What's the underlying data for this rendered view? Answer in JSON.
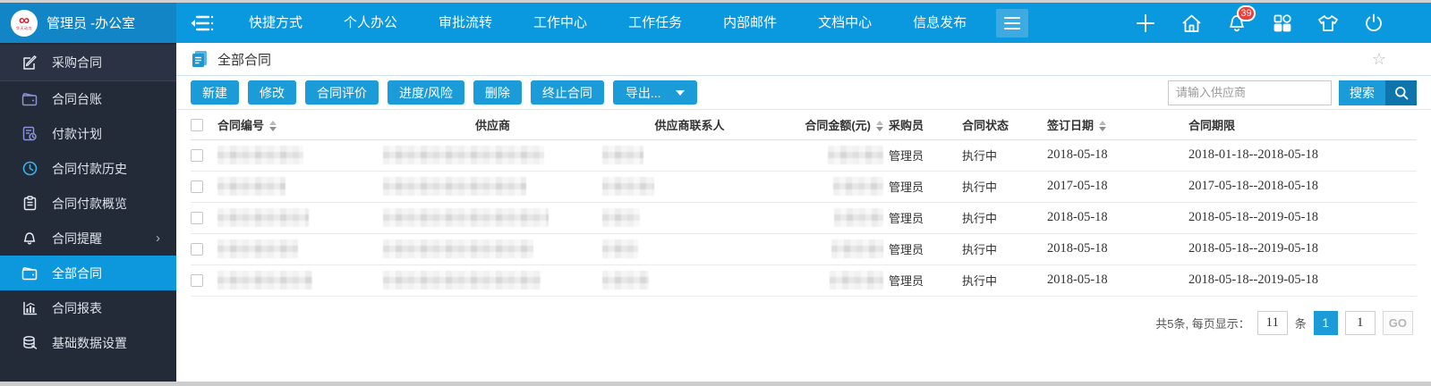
{
  "colors": {
    "topbar": "#0a98de",
    "topbar_left": "#1285c6",
    "sidebar": "#232a38",
    "accent": "#1b9cd8",
    "badge": "#e8403c"
  },
  "topbar": {
    "user_title": "管理员 -办公室",
    "menu": [
      {
        "label": "快捷方式"
      },
      {
        "label": "个人办公"
      },
      {
        "label": "审批流转"
      },
      {
        "label": "工作中心"
      },
      {
        "label": "工作任务"
      },
      {
        "label": "内部邮件"
      },
      {
        "label": "文档中心"
      },
      {
        "label": "信息发布"
      }
    ],
    "notification_count": "39",
    "icons": [
      "plus-icon",
      "home-icon",
      "bell-icon",
      "apps-grid-icon",
      "shirt-icon",
      "power-icon"
    ]
  },
  "sidebar": {
    "items": [
      {
        "label": "采购合同",
        "icon": "edit-document-icon"
      },
      {
        "label": "合同台账",
        "icon": "wallet-icon"
      },
      {
        "label": "付款计划",
        "icon": "payment-plan-icon"
      },
      {
        "label": "合同付款历史",
        "icon": "clock-icon"
      },
      {
        "label": "合同付款概览",
        "icon": "clipboard-icon"
      },
      {
        "label": "合同提醒",
        "icon": "bell-icon",
        "chevron": "›"
      },
      {
        "label": "全部合同",
        "icon": "wallet-icon",
        "active": true
      },
      {
        "label": "合同报表",
        "icon": "chart-icon"
      },
      {
        "label": "基础数据设置",
        "icon": "database-icon"
      }
    ]
  },
  "page": {
    "title": "全部合同"
  },
  "toolbar": {
    "buttons": [
      {
        "label": "新建"
      },
      {
        "label": "修改"
      },
      {
        "label": "合同评价"
      },
      {
        "label": "进度/风险"
      },
      {
        "label": "删除"
      },
      {
        "label": "终止合同"
      }
    ],
    "export_label": "导出...",
    "search_placeholder": "请输入供应商",
    "search_label": "搜索"
  },
  "table": {
    "columns": [
      "合同编号",
      "供应商",
      "供应商联系人",
      "合同金额(元)",
      "采购员",
      "合同状态",
      "签订日期",
      "合同期限"
    ],
    "sortable_columns": [
      "合同编号",
      "合同金额(元)",
      "签订日期"
    ],
    "redacted_columns": [
      "合同编号",
      "供应商",
      "供应商联系人",
      "合同金额(元)"
    ],
    "rows": [
      {
        "buyer": "管理员",
        "status": "执行中",
        "sign_date": "2018-05-18",
        "period": "2018-01-18--2018-05-18"
      },
      {
        "buyer": "管理员",
        "status": "执行中",
        "sign_date": "2017-05-18",
        "period": "2017-05-18--2018-05-18"
      },
      {
        "buyer": "管理员",
        "status": "执行中",
        "sign_date": "2018-05-18",
        "period": "2018-05-18--2019-05-18"
      },
      {
        "buyer": "管理员",
        "status": "执行中",
        "sign_date": "2018-05-18",
        "period": "2018-05-18--2019-05-18"
      },
      {
        "buyer": "管理员",
        "status": "执行中",
        "sign_date": "2018-05-18",
        "period": "2018-05-18--2019-05-18"
      }
    ]
  },
  "pagination": {
    "summary": "共5条, 每页显示：",
    "page_size": "11",
    "unit": "条",
    "current_page": "1",
    "page_input": "1",
    "go_label": "GO"
  }
}
